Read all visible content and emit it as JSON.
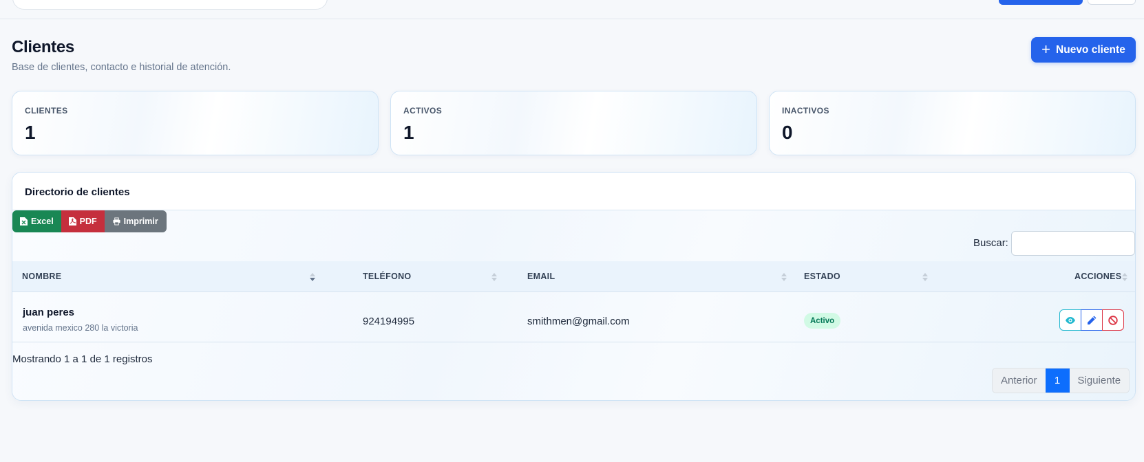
{
  "page": {
    "title": "Clientes",
    "subtitle": "Base de clientes, contacto e historial de atención.",
    "new_button": "Nuevo cliente"
  },
  "stats": [
    {
      "label": "CLIENTES",
      "value": "1"
    },
    {
      "label": "ACTIVOS",
      "value": "1"
    },
    {
      "label": "INACTIVOS",
      "value": "0"
    }
  ],
  "directory": {
    "title": "Directorio de clientes",
    "export": {
      "excel": "Excel",
      "pdf": "PDF",
      "print": "Imprimir"
    },
    "search_label": "Buscar:",
    "search_value": "",
    "columns": [
      "NOMBRE",
      "TELÉFONO",
      "EMAIL",
      "ESTADO",
      "ACCIONES"
    ],
    "rows": [
      {
        "name": "juan peres",
        "address": "avenida mexico 280 la victoria",
        "phone": "924194995",
        "email": "smithmen@gmail.com",
        "status": "Activo"
      }
    ],
    "info": "Mostrando 1 a 1 de 1 registros",
    "pagination": {
      "prev": "Anterior",
      "current": "1",
      "next": "Siguiente"
    }
  },
  "colors": {
    "primary": "#2563eb",
    "excel": "#198754",
    "pdf": "#c52f3d",
    "print": "#6c757d",
    "status_active_bg": "#d1fae5",
    "status_active_text": "#047857"
  }
}
